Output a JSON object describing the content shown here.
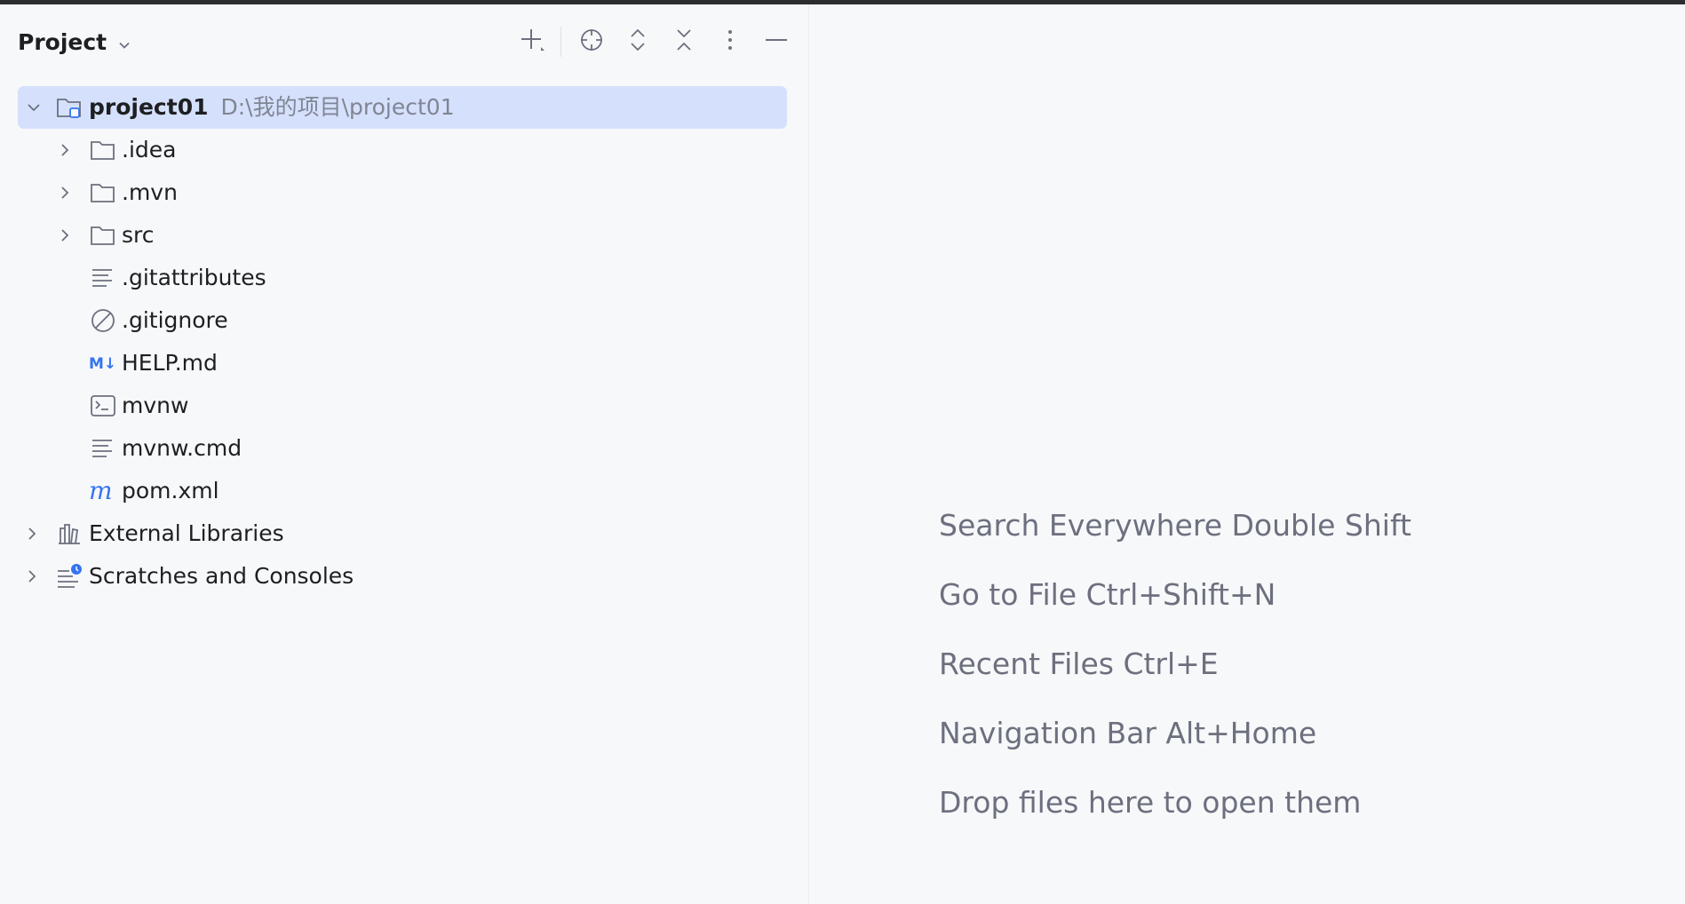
{
  "project_pane": {
    "title": "Project",
    "toolbar": [
      "add-icon",
      "locate-icon",
      "expand-all-icon",
      "collapse-all-icon",
      "more-icon",
      "minimize-icon"
    ]
  },
  "tree": {
    "root": {
      "name": "project01",
      "path": "D:\\我的项目\\project01"
    },
    "children": [
      {
        "name": ".idea",
        "icon": "folder-icon",
        "expandable": true
      },
      {
        "name": ".mvn",
        "icon": "folder-icon",
        "expandable": true
      },
      {
        "name": "src",
        "icon": "folder-icon",
        "expandable": true
      },
      {
        "name": ".gitattributes",
        "icon": "text-file-icon",
        "expandable": false
      },
      {
        "name": ".gitignore",
        "icon": "ignore-file-icon",
        "expandable": false
      },
      {
        "name": "HELP.md",
        "icon": "markdown-icon",
        "expandable": false
      },
      {
        "name": "mvnw",
        "icon": "shell-script-icon",
        "expandable": false
      },
      {
        "name": "mvnw.cmd",
        "icon": "text-file-icon",
        "expandable": false
      },
      {
        "name": "pom.xml",
        "icon": "maven-icon",
        "expandable": false
      }
    ],
    "external_libraries": "External Libraries",
    "scratches": "Scratches and Consoles"
  },
  "editor": {
    "hints": [
      "Search Everywhere Double Shift",
      "Go to File Ctrl+Shift+N",
      "Recent Files Ctrl+E",
      "Navigation Bar Alt+Home",
      "Drop files here to open them"
    ]
  },
  "colors": {
    "selection": "#d5e1fc",
    "accent": "#3574f0",
    "hint_text": "#6c707e",
    "path_text": "#818594"
  }
}
